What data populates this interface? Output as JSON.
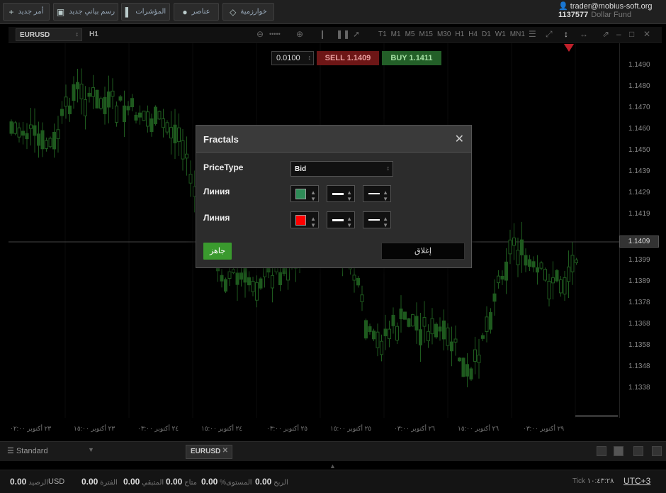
{
  "topbar": {
    "buttons": [
      {
        "label": "أمر جديد",
        "icon": "plus-icon"
      },
      {
        "label": "رسم بياني جديد",
        "icon": "chart-icon"
      },
      {
        "label": "المؤشرات",
        "icon": "indicators-icon"
      },
      {
        "label": "عناصر",
        "icon": "elements-icon"
      },
      {
        "label": "خوارزمية",
        "icon": "diamond-icon"
      }
    ],
    "account": {
      "user": "trader@mobius-soft.org",
      "number": "1137577",
      "fund": "Dollar Fund"
    }
  },
  "chart": {
    "symbol": "EURUSD",
    "timeframe": "H1",
    "timeframes": [
      "T1",
      "M1",
      "M5",
      "M15",
      "M30",
      "H1",
      "H4",
      "D1",
      "W1",
      "MN1"
    ],
    "lot": "0.0100",
    "sell_label": "SELL",
    "sell_price": "1.1409",
    "buy_label": "BUY",
    "buy_price": "1.1411",
    "current_price": "1.1409",
    "price_ticks": [
      "1.1490",
      "1.1480",
      "1.1470",
      "1.1460",
      "1.1450",
      "1.1439",
      "1.1429",
      "1.1419",
      "1.1399",
      "1.1389",
      "1.1378",
      "1.1368",
      "1.1358",
      "1.1348",
      "1.1338"
    ],
    "time_labels": [
      "٢٣ أكتوبر ٠٢:٠٠",
      "٢٣ أكتوبر ١٥:٠٠",
      "٢٤ أكتوبر ٠٣:٠٠",
      "٢٤ أكتوبر ١٥:٠٠",
      "٢٥ أكتوبر ٠٣:٠٠",
      "٢٥ أكتوبر ١٥:٠٠",
      "٢٦ أكتوبر ٠٣:٠٠",
      "٢٦ أكتوبر ١٥:٠٠",
      "٢٩ أكتوبر ٠٣:٠٠"
    ],
    "candle_color": "#1e5a1e"
  },
  "dialog": {
    "title": "Fractals",
    "pricetype_label": "PriceType",
    "pricetype_value": "Bid",
    "line1_label": "Линия",
    "line1_color": "#2e8b57",
    "line2_label": "Линия",
    "line2_color": "#ff0000",
    "ok_label": "جاهز",
    "close_label": "إغلاق"
  },
  "bottom": {
    "workspace": "Standard",
    "tab": "EURUSD"
  },
  "status": {
    "balance_value": "0.00",
    "balance_label": "الرصيد",
    "currency": "USD",
    "credit_value": "0.00",
    "credit_label": "الفترة",
    "equity_value": "0.00",
    "equity_label": "المتبقي",
    "margin_value": "0.00",
    "margin_label": "متاح",
    "level_value": "0.00",
    "level_label": "%المستوى",
    "profit_value": "0.00",
    "profit_label": "الربح",
    "tick_label": "Tick",
    "time": "١٠:٤٣:٢٨",
    "timezone": "UTC+3"
  }
}
